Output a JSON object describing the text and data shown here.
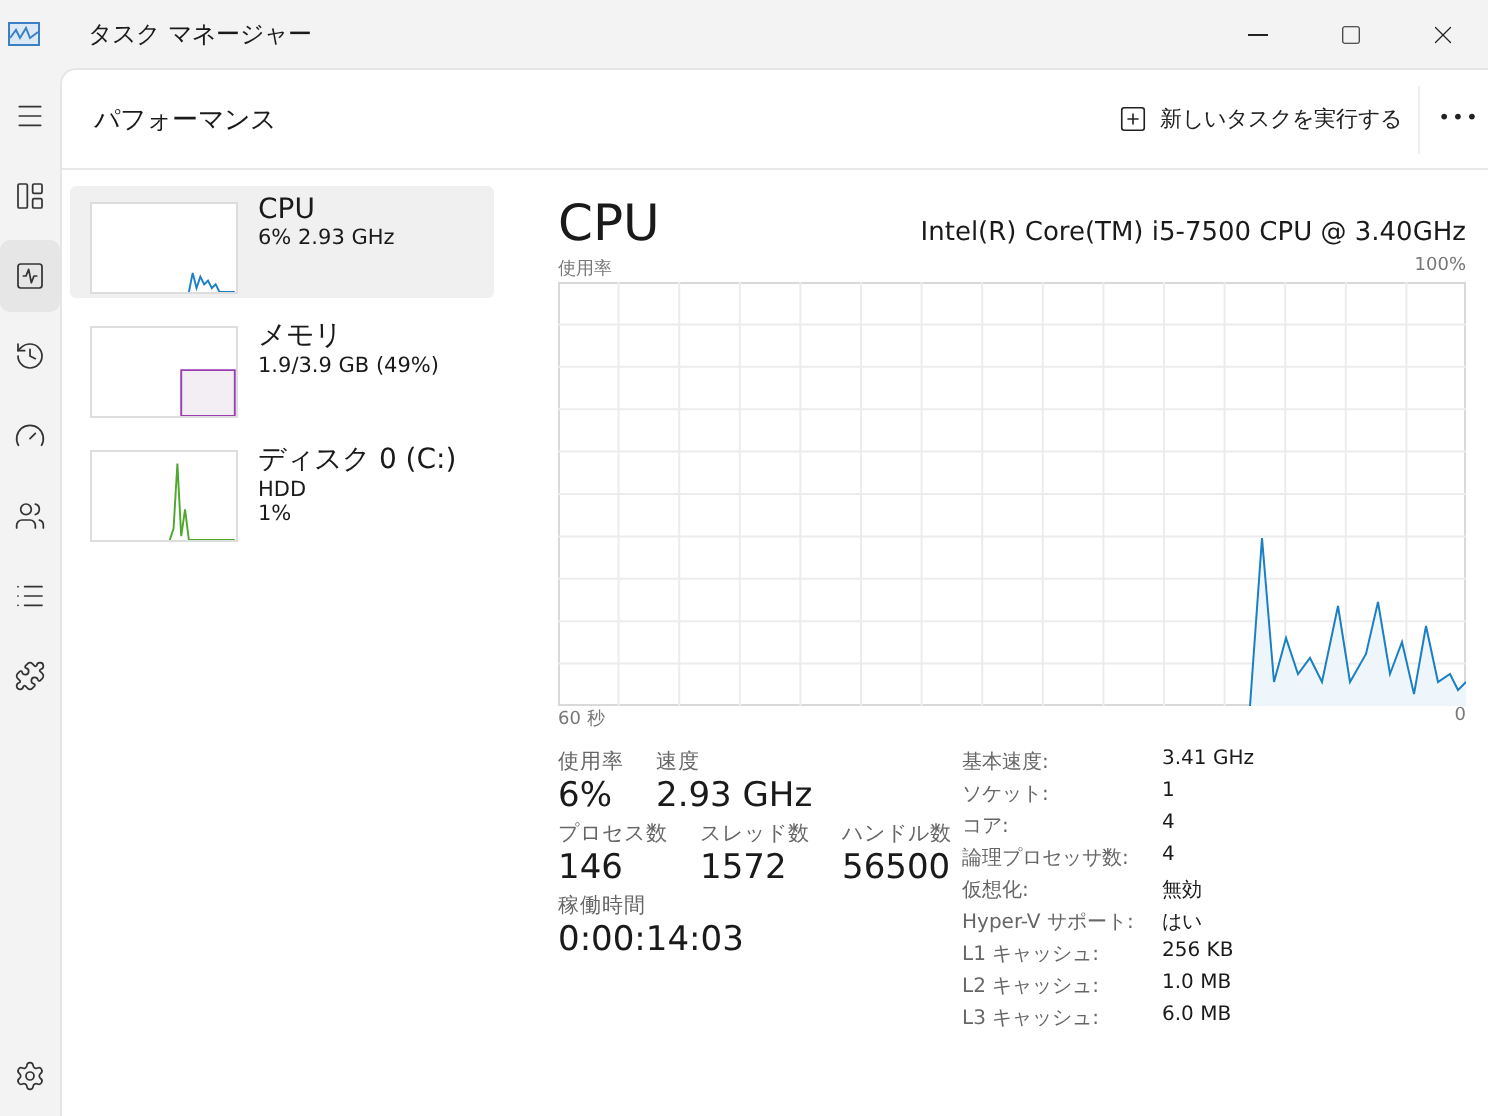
{
  "window": {
    "title": "タスク マネージャー"
  },
  "nav": [
    {
      "kind": "menu",
      "selected": false
    },
    {
      "kind": "processes",
      "selected": false
    },
    {
      "kind": "performance",
      "selected": true
    },
    {
      "kind": "history",
      "selected": false
    },
    {
      "kind": "startup",
      "selected": false
    },
    {
      "kind": "users",
      "selected": false
    },
    {
      "kind": "details",
      "selected": false
    },
    {
      "kind": "services",
      "selected": false
    },
    {
      "kind": "settings",
      "selected": false
    }
  ],
  "header": {
    "title": "パフォーマンス",
    "run_task": "新しいタスクを実行する",
    "more": "•••"
  },
  "devices": [
    {
      "kind": "cpu",
      "name": "CPU",
      "lines": [
        "6%  2.93 GHz"
      ],
      "color": "#1b7fc4",
      "selected": true
    },
    {
      "kind": "memory",
      "name": "メモリ",
      "lines": [
        "1.9/3.9 GB (49%)"
      ],
      "color": "#9b3eb2",
      "selected": false
    },
    {
      "kind": "disk",
      "name": "ディスク 0 (C:)",
      "lines": [
        "HDD",
        "1%"
      ],
      "color": "#4da82c",
      "selected": false
    }
  ],
  "detail": {
    "title": "CPU",
    "model": "Intel(R) Core(TM) i5-7500 CPU @ 3.40GHz",
    "graph_label": "使用率",
    "graph_max": "100%",
    "x_start": "60 秒",
    "x_end": "0",
    "stats": [
      [
        {
          "label": "使用率",
          "value": "6%"
        },
        {
          "label": "速度",
          "value": "2.93 GHz"
        }
      ],
      [
        {
          "label": "プロセス数",
          "value": "146"
        },
        {
          "label": "スレッド数",
          "value": "1572"
        },
        {
          "label": "ハンドル数",
          "value": "56500"
        }
      ],
      [
        {
          "label": "稼働時間",
          "value": "0:00:14:03"
        }
      ]
    ],
    "specs": [
      {
        "label": "基本速度:",
        "value": "3.41 GHz"
      },
      {
        "label": "ソケット:",
        "value": "1"
      },
      {
        "label": "コア:",
        "value": "4"
      },
      {
        "label": "論理プロセッサ数:",
        "value": "4"
      },
      {
        "label": "仮想化:",
        "value": "無効"
      },
      {
        "label": "Hyper-V サポート:",
        "value": "はい"
      },
      {
        "label": "L1 キャッシュ:",
        "value": "256 KB"
      },
      {
        "label": "L2 キャッシュ:",
        "value": "1.0 MB"
      },
      {
        "label": "L3 キャッシュ:",
        "value": "6.0 MB"
      }
    ]
  }
}
